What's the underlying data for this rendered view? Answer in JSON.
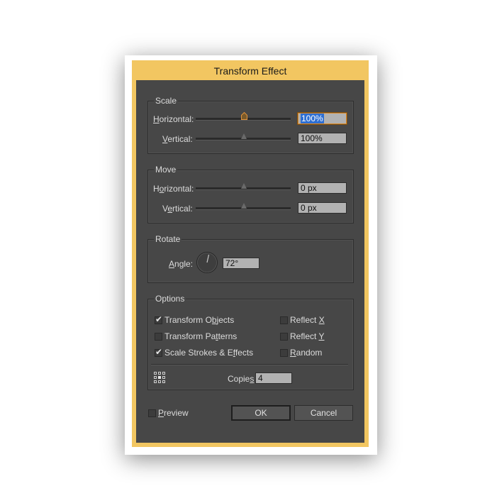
{
  "dialog": {
    "title": "Transform Effect"
  },
  "scale": {
    "title": "Scale",
    "horizontal": {
      "label_u": "H",
      "label_rest": "orizontal:",
      "value": "100%",
      "slider_fraction": 0.5
    },
    "vertical": {
      "label_pre": "",
      "label_u": "V",
      "label_rest": "ertical:",
      "value": "100%",
      "slider_fraction": 0.5
    }
  },
  "move": {
    "title": "Move",
    "horizontal": {
      "label_pre": "H",
      "label_u": "o",
      "label_rest": "rizontal:",
      "value": "0 px",
      "slider_fraction": 0.5
    },
    "vertical": {
      "label_pre": "V",
      "label_u": "e",
      "label_rest": "rtical:",
      "value": "0 px",
      "slider_fraction": 0.5
    }
  },
  "rotate": {
    "title": "Rotate",
    "angle": {
      "label_u": "A",
      "label_rest": "ngle:",
      "value": "72°"
    }
  },
  "options": {
    "title": "Options",
    "transform_objects": {
      "pre": "Transform O",
      "u": "b",
      "post": "jects",
      "checked": true
    },
    "transform_patterns": {
      "pre": "Transform Pa",
      "u": "t",
      "post": "terns",
      "checked": false
    },
    "scale_strokes": {
      "pre": "Scale Strokes & E",
      "u": "f",
      "post": "fects",
      "checked": true
    },
    "reflect_x": {
      "pre": "Reflect ",
      "u": "X",
      "post": "",
      "checked": false
    },
    "reflect_y": {
      "pre": "Reflect ",
      "u": "Y",
      "post": "",
      "checked": false
    },
    "random": {
      "pre": "",
      "u": "R",
      "post": "andom",
      "checked": false
    },
    "copies": {
      "pre": "Copie",
      "u": "s",
      "post": "",
      "value": "4"
    }
  },
  "footer": {
    "preview": {
      "u": "P",
      "post": "review",
      "checked": false
    },
    "ok_label": "OK",
    "cancel_label": "Cancel"
  },
  "colors": {
    "frame": "#f2c661",
    "panel": "#474747",
    "focus": "#d88a2c",
    "selection": "#2e6fd3"
  }
}
